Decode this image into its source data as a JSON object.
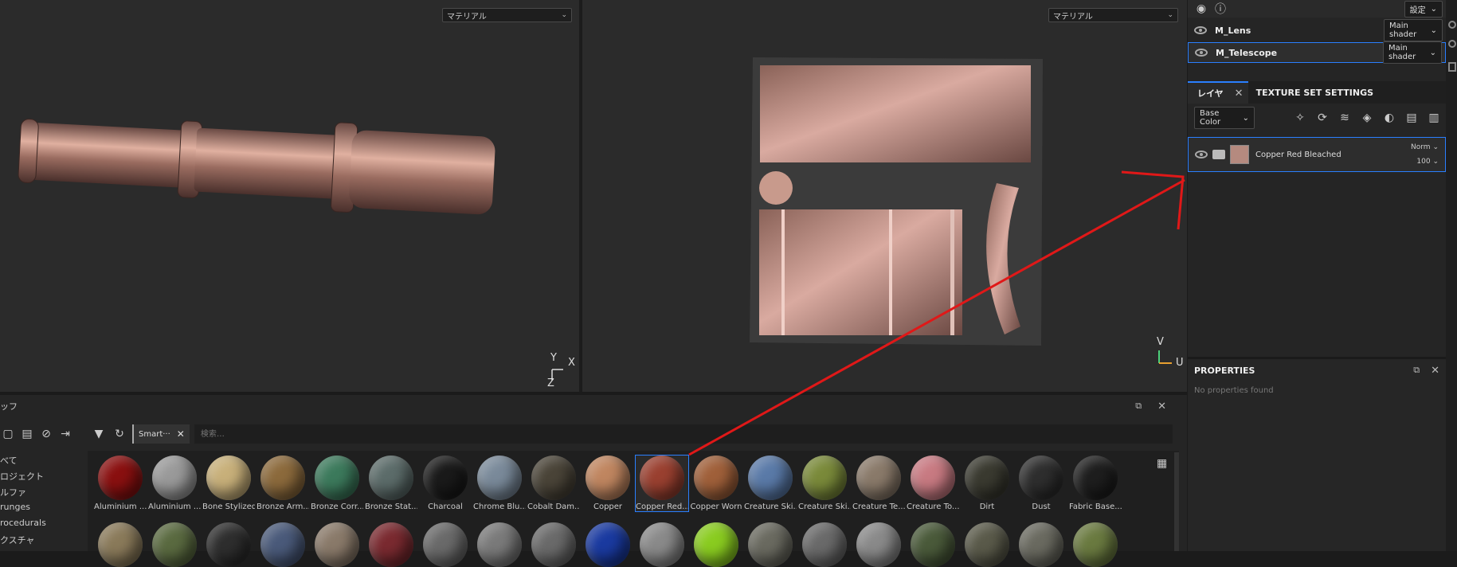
{
  "viewport3d": {
    "dropdown": "マテリアル",
    "axis": {
      "y": "Y",
      "x": "X",
      "z": "Z"
    }
  },
  "viewport2d": {
    "dropdown": "マテリアル",
    "axis": {
      "v": "V",
      "u": "U"
    }
  },
  "texture_sets": {
    "settings_label": "設定",
    "items": [
      {
        "name": "M_Lens",
        "shader": "Main shader",
        "selected": false
      },
      {
        "name": "M_Telescope",
        "shader": "Main shader",
        "selected": true
      }
    ]
  },
  "layers": {
    "tab_layers": "レイヤ",
    "tab_texture_set_settings": "TEXTURE SET SETTINGS",
    "channel": "Base Color",
    "layer": {
      "name": "Copper Red Bleached",
      "blend": "Norm",
      "opacity": "100",
      "swatch": "#b58a7f"
    }
  },
  "properties": {
    "title": "PROPERTIES",
    "empty": "No properties found"
  },
  "shelf": {
    "title": "ッフ",
    "filter_chip": "Smart···",
    "search_placeholder": "検索…",
    "categories": [
      "べて",
      "ロジェクト",
      "ルファ",
      "runges",
      "rocedurals",
      "クスチャ"
    ],
    "row1": [
      {
        "label": "Aluminium ...",
        "color": "#8a1010"
      },
      {
        "label": "Aluminium ...",
        "color": "#9a9a9a"
      },
      {
        "label": "Bone Stylized",
        "color": "#c8b07a"
      },
      {
        "label": "Bronze Arm...",
        "color": "#8c6a3c"
      },
      {
        "label": "Bronze Corr...",
        "color": "#3c7a5c"
      },
      {
        "label": "Bronze Stat...",
        "color": "#5c6c6a"
      },
      {
        "label": "Charcoal",
        "color": "#1a1a1a"
      },
      {
        "label": "Chrome Blu...",
        "color": "#7a8a9a"
      },
      {
        "label": "Cobalt Dam...",
        "color": "#4a4438"
      },
      {
        "label": "Copper",
        "color": "#c08660"
      },
      {
        "label": "Copper Red...",
        "color": "#9a4030",
        "selected": true
      },
      {
        "label": "Copper Worn",
        "color": "#a0603a"
      },
      {
        "label": "Creature Ski...",
        "color": "#5a7aa8"
      },
      {
        "label": "Creature Ski...",
        "color": "#7a8a3a"
      },
      {
        "label": "Creature Te...",
        "color": "#8a7a6a"
      },
      {
        "label": "Creature To...",
        "color": "#c87a82"
      },
      {
        "label": "Dirt",
        "color": "#3a3a30"
      },
      {
        "label": "Dust",
        "color": "#2e2e2e"
      },
      {
        "label": "Fabric Base...",
        "color": "#1e1e1e"
      }
    ],
    "row2_colors": [
      "#8a7a5a",
      "#5a6a40",
      "#2e2e2e",
      "#4a5a7a",
      "#8a7a6a",
      "#7a2a30",
      "#6a6a6a",
      "#7a7a7a",
      "#6a6a6a",
      "#1a3aa0",
      "#8a8a8a",
      "#8acc20",
      "#6a6a60",
      "#6a6a6a",
      "#8a8a8a",
      "#4a5a3a",
      "#5a5a4a",
      "#6a6a60",
      "#6a7a40"
    ]
  }
}
